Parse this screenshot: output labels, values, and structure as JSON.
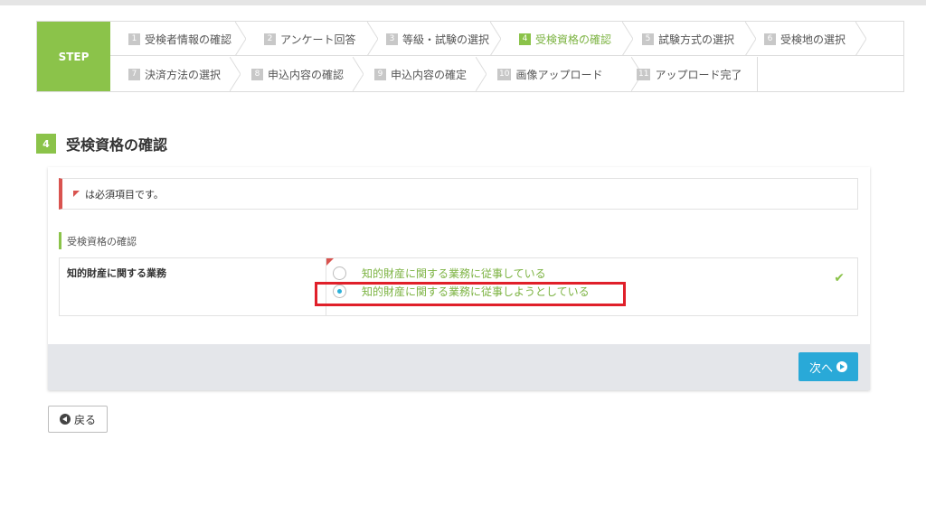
{
  "steps": {
    "label": "STEP",
    "items": [
      {
        "num": "1",
        "label": "受検者情報の確認"
      },
      {
        "num": "2",
        "label": "アンケート回答"
      },
      {
        "num": "3",
        "label": "等級・試験の選択"
      },
      {
        "num": "4",
        "label": "受検資格の確認"
      },
      {
        "num": "5",
        "label": "試験方式の選択"
      },
      {
        "num": "6",
        "label": "受検地の選択"
      },
      {
        "num": "7",
        "label": "決済方法の選択"
      },
      {
        "num": "8",
        "label": "申込内容の確認"
      },
      {
        "num": "9",
        "label": "申込内容の確定"
      },
      {
        "num": "10",
        "label": "画像アップロード"
      },
      {
        "num": "11",
        "label": "アップロード完了"
      }
    ]
  },
  "section": {
    "num": "4",
    "title": "受検資格の確認"
  },
  "notice": {
    "text": "は必須項目です。"
  },
  "subsection": {
    "label": "受検資格の確認"
  },
  "field": {
    "label": "知的財産に関する業務",
    "options": [
      {
        "label": "知的財産に関する業務に従事している",
        "selected": false
      },
      {
        "label": "知的財産に関する業務に従事しようとしている",
        "selected": true
      }
    ],
    "status_icon": "checkmark-icon"
  },
  "buttons": {
    "next": "次へ",
    "back": "戻る"
  },
  "colors": {
    "accent": "#8bc34a",
    "button": "#29a9d8",
    "required": "#d9534f",
    "highlight": "#e0202a"
  }
}
